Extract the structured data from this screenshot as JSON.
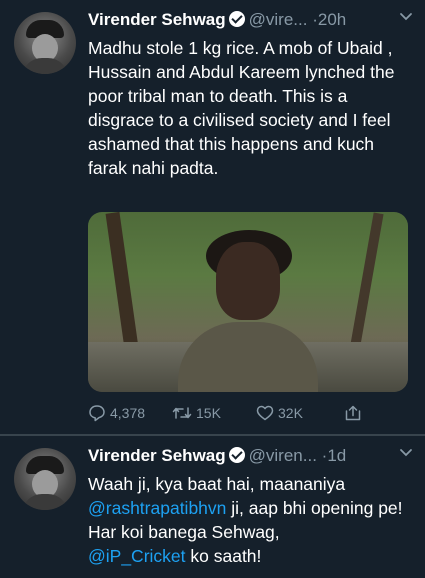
{
  "tweets": [
    {
      "name": "Virender Sehwag",
      "handle": "@vire...",
      "time": "·20h",
      "text": "Madhu stole 1 kg rice. A mob of Ubaid , Hussain and Abdul Kareem lynched the poor tribal man to death. This is a disgrace to a civilised society and I feel ashamed that this happens and kuch farak nahi padta.",
      "replies": "4,378",
      "retweets": "15K",
      "likes": "32K"
    },
    {
      "name": "Virender Sehwag",
      "handle": "@viren...",
      "time": "·1d",
      "text_line1": "Waah ji, kya baat hai, maananiya",
      "mention1": "@rashtrapatibhvn",
      "text_line2_rest": " ji, aap bhi opening pe!",
      "text_line3": "Har koi banega Sehwag,",
      "mention2": "@iP_Cricket",
      "text_line4_rest": " ko saath!"
    }
  ],
  "icons": {
    "chevron": "chevron-down-icon",
    "verified": "verified-badge-icon",
    "reply": "reply-icon",
    "retweet": "retweet-icon",
    "like": "heart-icon",
    "share": "share-icon"
  },
  "colors": {
    "background": "#15202b",
    "secondary_text": "#8899a6",
    "link": "#1da1f2",
    "divider": "#38444d"
  }
}
